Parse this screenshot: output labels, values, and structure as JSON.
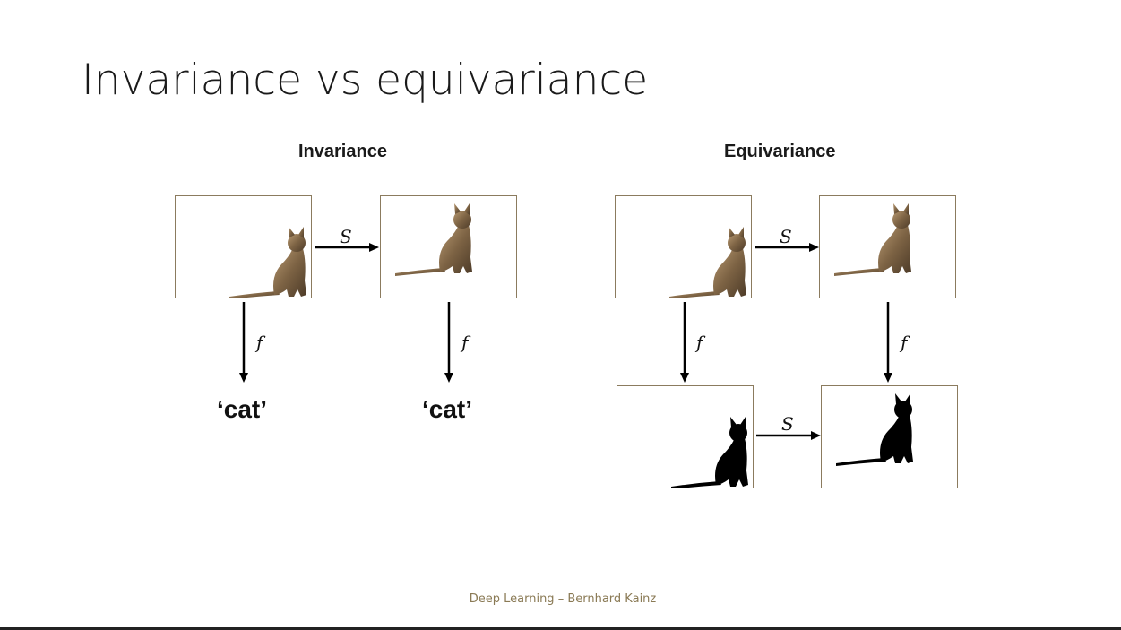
{
  "slide": {
    "title": "Invariance vs equivariance",
    "footer": "Deep Learning – Bernhard Kainz"
  },
  "invariance": {
    "heading": "Invariance",
    "shift_label": "S",
    "map_label": "f",
    "output_left": "‘cat’",
    "output_right": "‘cat’"
  },
  "equivariance": {
    "heading": "Equivariance",
    "shift_label_top": "S",
    "shift_label_bottom": "S",
    "map_label": "f"
  },
  "colors": {
    "frame_border": "#8b7b5e",
    "footer_text": "#8a7a55",
    "cat_photo": "#8a6d4a",
    "cat_silhouette": "#000000"
  }
}
